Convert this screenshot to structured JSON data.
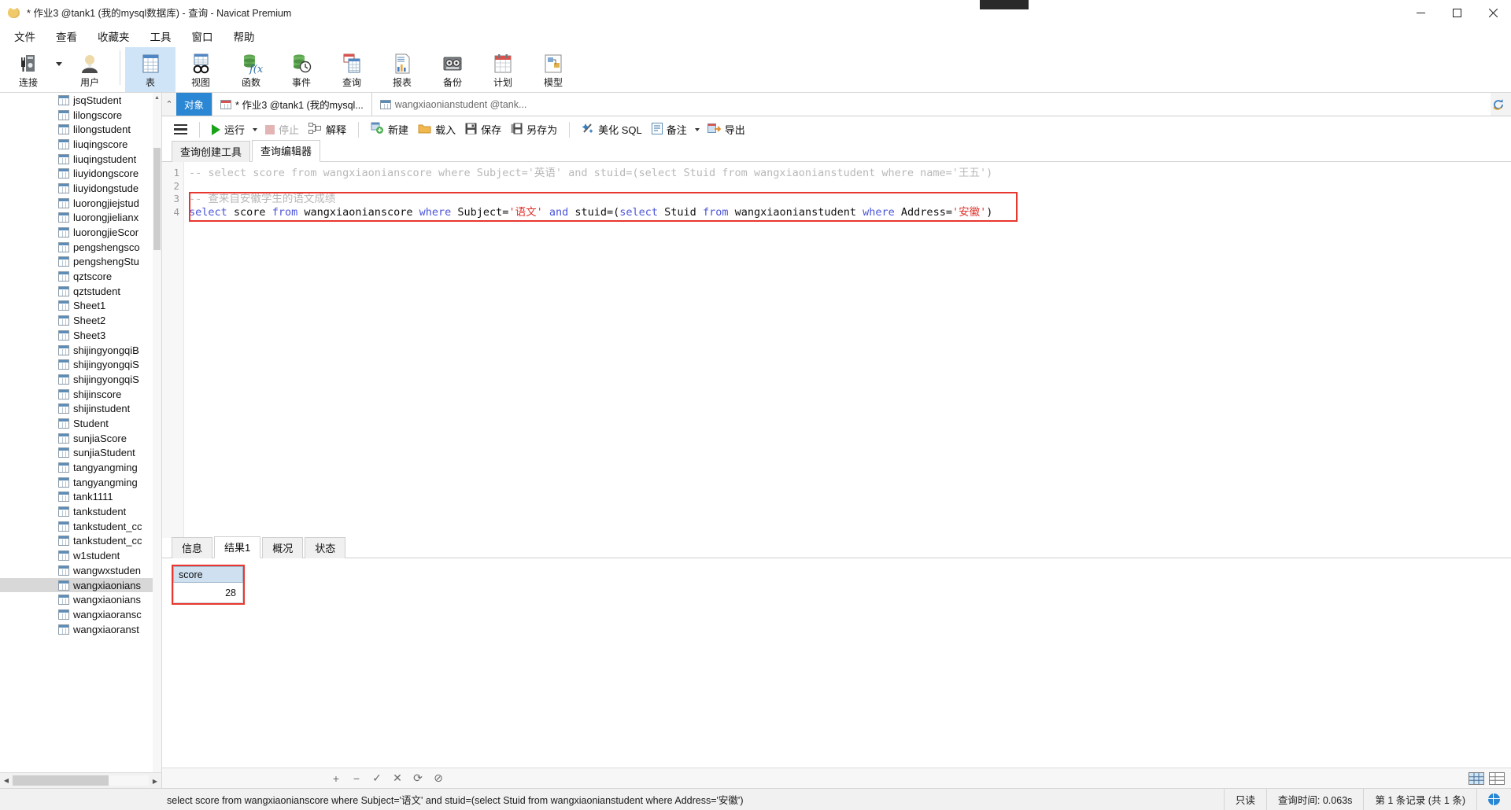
{
  "window": {
    "title": "* 作业3 @tank1 (我的mysql数据库) - 查询 - Navicat Premium",
    "minimize": "–",
    "maximize": "▢",
    "close": "✕"
  },
  "menu": {
    "items": [
      "文件",
      "查看",
      "收藏夹",
      "工具",
      "窗口",
      "帮助"
    ]
  },
  "toolbar": {
    "items": [
      {
        "label": "连接",
        "icon": "connection-icon",
        "selected": false,
        "has_caret": true
      },
      {
        "label": "用户",
        "icon": "user-icon",
        "selected": false,
        "has_caret": false
      },
      {
        "label": "表",
        "icon": "table-icon",
        "selected": true,
        "has_caret": false
      },
      {
        "label": "视图",
        "icon": "view-icon",
        "selected": false,
        "has_caret": false
      },
      {
        "label": "函数",
        "icon": "function-icon",
        "selected": false,
        "has_caret": false
      },
      {
        "label": "事件",
        "icon": "event-icon",
        "selected": false,
        "has_caret": false
      },
      {
        "label": "查询",
        "icon": "query-icon",
        "selected": false,
        "has_caret": false
      },
      {
        "label": "报表",
        "icon": "report-icon",
        "selected": false,
        "has_caret": false
      },
      {
        "label": "备份",
        "icon": "backup-icon",
        "selected": false,
        "has_caret": false
      },
      {
        "label": "计划",
        "icon": "schedule-icon",
        "selected": false,
        "has_caret": false
      },
      {
        "label": "模型",
        "icon": "model-icon",
        "selected": false,
        "has_caret": false
      }
    ]
  },
  "sidebar": {
    "tables": [
      {
        "name": "jsqStudent",
        "selected": false
      },
      {
        "name": "lilongscore",
        "selected": false
      },
      {
        "name": "lilongstudent",
        "selected": false
      },
      {
        "name": "liuqingscore",
        "selected": false
      },
      {
        "name": "liuqingstudent",
        "selected": false
      },
      {
        "name": "liuyidongscore",
        "selected": false
      },
      {
        "name": "liuyidongstude",
        "selected": false
      },
      {
        "name": "luorongjiejstud",
        "selected": false
      },
      {
        "name": "luorongjielianx",
        "selected": false
      },
      {
        "name": "luorongjieScor",
        "selected": false
      },
      {
        "name": "pengshengsco",
        "selected": false
      },
      {
        "name": "pengshengStu",
        "selected": false
      },
      {
        "name": "qztscore",
        "selected": false
      },
      {
        "name": "qztstudent",
        "selected": false
      },
      {
        "name": "Sheet1",
        "selected": false
      },
      {
        "name": "Sheet2",
        "selected": false
      },
      {
        "name": "Sheet3",
        "selected": false
      },
      {
        "name": "shijingyongqiB",
        "selected": false
      },
      {
        "name": "shijingyongqiS",
        "selected": false
      },
      {
        "name": "shijingyongqiS",
        "selected": false
      },
      {
        "name": "shijinscore",
        "selected": false
      },
      {
        "name": "shijinstudent",
        "selected": false
      },
      {
        "name": "Student",
        "selected": false
      },
      {
        "name": "sunjiaScore",
        "selected": false
      },
      {
        "name": "sunjiaStudent",
        "selected": false
      },
      {
        "name": "tangyangming",
        "selected": false
      },
      {
        "name": "tangyangming",
        "selected": false
      },
      {
        "name": "tank1111",
        "selected": false
      },
      {
        "name": "tankstudent",
        "selected": false
      },
      {
        "name": "tankstudent_cc",
        "selected": false
      },
      {
        "name": "tankstudent_cc",
        "selected": false
      },
      {
        "name": "w1student",
        "selected": false
      },
      {
        "name": "wangwxstuden",
        "selected": false
      },
      {
        "name": "wangxiaonians",
        "selected": true
      },
      {
        "name": "wangxiaonians",
        "selected": false
      },
      {
        "name": "wangxiaoransc",
        "selected": false
      },
      {
        "name": "wangxiaoranst",
        "selected": false
      }
    ]
  },
  "object_tabs": {
    "collapse_icon": "chevron-up-icon",
    "object_label": "对象",
    "query_tab": "* 作业3 @tank1 (我的mysql...",
    "table_tab": "wangxiaonianstudent @tank...",
    "refresh_icon": "refresh-icon"
  },
  "query_toolbar": {
    "menu_icon": "hamburger-icon",
    "run": "运行",
    "stop": "停止",
    "explain": "解释",
    "new": "新建",
    "load": "载入",
    "save": "保存",
    "save_as": "另存为",
    "beautify": "美化 SQL",
    "comment": "备注",
    "export": "导出"
  },
  "editor_tabs": {
    "builder": "查询创建工具",
    "editor": "查询编辑器"
  },
  "editor": {
    "line_numbers": [
      "1",
      "2",
      "3",
      "4"
    ],
    "lines": [
      {
        "n": 1,
        "kind": "comment",
        "text": "-- select score from wangxiaonianscore where Subject='英语' and stuid=(select Stuid from wangxiaonianstudent where name='王五')"
      },
      {
        "n": 2,
        "kind": "blank",
        "text": ""
      },
      {
        "n": 3,
        "kind": "comment",
        "text": "-- 查来自安徽学生的语文成绩"
      },
      {
        "n": 4,
        "kind": "sql",
        "text": "select score from wangxiaonianscore where Subject='语文' and stuid=(select Stuid from wangxiaonianstudent where Address='安徽')",
        "tokens": [
          {
            "t": "select",
            "c": "kw"
          },
          {
            "t": " score ",
            "c": "txt"
          },
          {
            "t": "from",
            "c": "kw"
          },
          {
            "t": " wangxiaonianscore ",
            "c": "txt"
          },
          {
            "t": "where",
            "c": "kw"
          },
          {
            "t": " Subject=",
            "c": "txt"
          },
          {
            "t": "'语文'",
            "c": "str"
          },
          {
            "t": " ",
            "c": "txt"
          },
          {
            "t": "and",
            "c": "kw"
          },
          {
            "t": " stuid=(",
            "c": "txt"
          },
          {
            "t": "select",
            "c": "kw"
          },
          {
            "t": " Stuid ",
            "c": "txt"
          },
          {
            "t": "from",
            "c": "kw"
          },
          {
            "t": " wangxiaonianstudent ",
            "c": "txt"
          },
          {
            "t": "where",
            "c": "kw"
          },
          {
            "t": " Address=",
            "c": "txt"
          },
          {
            "t": "'安徽'",
            "c": "str"
          },
          {
            "t": ")",
            "c": "txt"
          }
        ]
      }
    ],
    "highlight_color": "#e8372f"
  },
  "results": {
    "tabs": [
      {
        "label": "信息",
        "active": false
      },
      {
        "label": "结果1",
        "active": true
      },
      {
        "label": "概况",
        "active": false
      },
      {
        "label": "状态",
        "active": false
      }
    ],
    "columns": [
      "score"
    ],
    "rows": [
      [
        "28"
      ]
    ],
    "highlight_color": "#e8372f"
  },
  "grid_toolbar": {
    "add_icon": "plus-icon",
    "remove_icon": "minus-icon",
    "apply_icon": "check-icon",
    "cancel_icon": "cross-icon",
    "refresh_icon": "refresh-icon",
    "stop_icon": "ban-icon",
    "grid_view_icon": "grid-view-icon",
    "form_view_icon": "form-view-icon"
  },
  "statusbar": {
    "sql": "select score from wangxiaonianscore where Subject='语文' and stuid=(select Stuid from wangxiaonianstudent where Address='安徽')",
    "readonly": "只读",
    "time": "查询时间: 0.063s",
    "records": "第 1 条记录 (共 1 条)",
    "globe_icon": "globe-icon"
  }
}
